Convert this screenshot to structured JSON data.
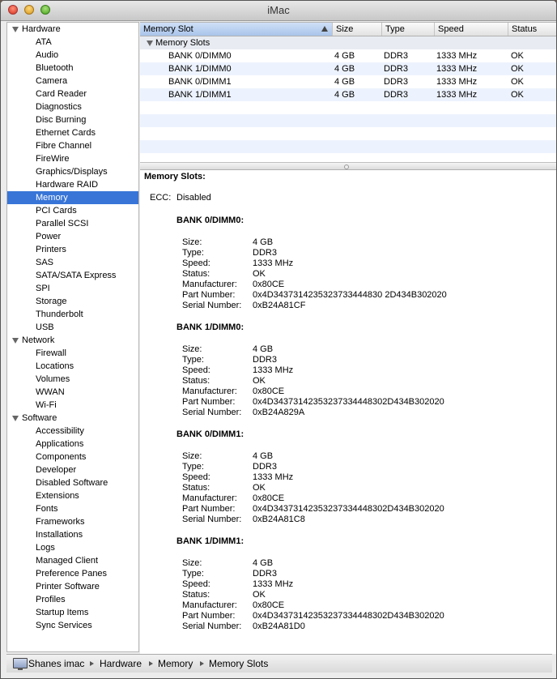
{
  "window": {
    "title": "iMac"
  },
  "sidebar": {
    "groups": [
      {
        "label": "Hardware",
        "items": [
          "ATA",
          "Audio",
          "Bluetooth",
          "Camera",
          "Card Reader",
          "Diagnostics",
          "Disc Burning",
          "Ethernet Cards",
          "Fibre Channel",
          "FireWire",
          "Graphics/Displays",
          "Hardware RAID",
          "Memory",
          "PCI Cards",
          "Parallel SCSI",
          "Power",
          "Printers",
          "SAS",
          "SATA/SATA Express",
          "SPI",
          "Storage",
          "Thunderbolt",
          "USB"
        ]
      },
      {
        "label": "Network",
        "items": [
          "Firewall",
          "Locations",
          "Volumes",
          "WWAN",
          "Wi-Fi"
        ]
      },
      {
        "label": "Software",
        "items": [
          "Accessibility",
          "Applications",
          "Components",
          "Developer",
          "Disabled Software",
          "Extensions",
          "Fonts",
          "Frameworks",
          "Installations",
          "Logs",
          "Managed Client",
          "Preference Panes",
          "Printer Software",
          "Profiles",
          "Startup Items",
          "Sync Services"
        ]
      }
    ],
    "selected": "Memory"
  },
  "table": {
    "columns": [
      "Memory Slot",
      "Size",
      "Type",
      "Speed",
      "Status"
    ],
    "group_label": "Memory Slots",
    "rows": [
      [
        "BANK 0/DIMM0",
        "4 GB",
        "DDR3",
        "1333 MHz",
        "OK"
      ],
      [
        "BANK 1/DIMM0",
        "4 GB",
        "DDR3",
        "1333 MHz",
        "OK"
      ],
      [
        "BANK 0/DIMM1",
        "4 GB",
        "DDR3",
        "1333 MHz",
        "OK"
      ],
      [
        "BANK 1/DIMM1",
        "4 GB",
        "DDR3",
        "1333 MHz",
        "OK"
      ]
    ]
  },
  "detail": {
    "heading": "Memory Slots:",
    "ecc_label": "ECC:",
    "ecc_value": "Disabled",
    "field_labels": [
      "Size:",
      "Type:",
      "Speed:",
      "Status:",
      "Manufacturer:",
      "Part Number:",
      "Serial Number:"
    ],
    "banks": [
      {
        "name": "BANK 0/DIMM0:",
        "values": [
          "4 GB",
          "DDR3",
          "1333 MHz",
          "OK",
          "0x80CE",
          "0x4D3437314235323733444830 2D434B302020",
          "0xB24A81CF"
        ]
      },
      {
        "name": "BANK 1/DIMM0:",
        "values": [
          "4 GB",
          "DDR3",
          "1333 MHz",
          "OK",
          "0x80CE",
          "0x4D34373142353237334448302D434B302020",
          "0xB24A829A"
        ]
      },
      {
        "name": "BANK 0/DIMM1:",
        "values": [
          "4 GB",
          "DDR3",
          "1333 MHz",
          "OK",
          "0x80CE",
          "0x4D34373142353237334448302D434B302020",
          "0xB24A81C8"
        ]
      },
      {
        "name": "BANK 1/DIMM1:",
        "values": [
          "4 GB",
          "DDR3",
          "1333 MHz",
          "OK",
          "0x80CE",
          "0x4D34373142353237334448302D434B302020",
          "0xB24A81D0"
        ]
      }
    ]
  },
  "pathbar": {
    "crumbs": [
      "Shanes imac",
      "Hardware",
      "Memory",
      "Memory Slots"
    ]
  }
}
